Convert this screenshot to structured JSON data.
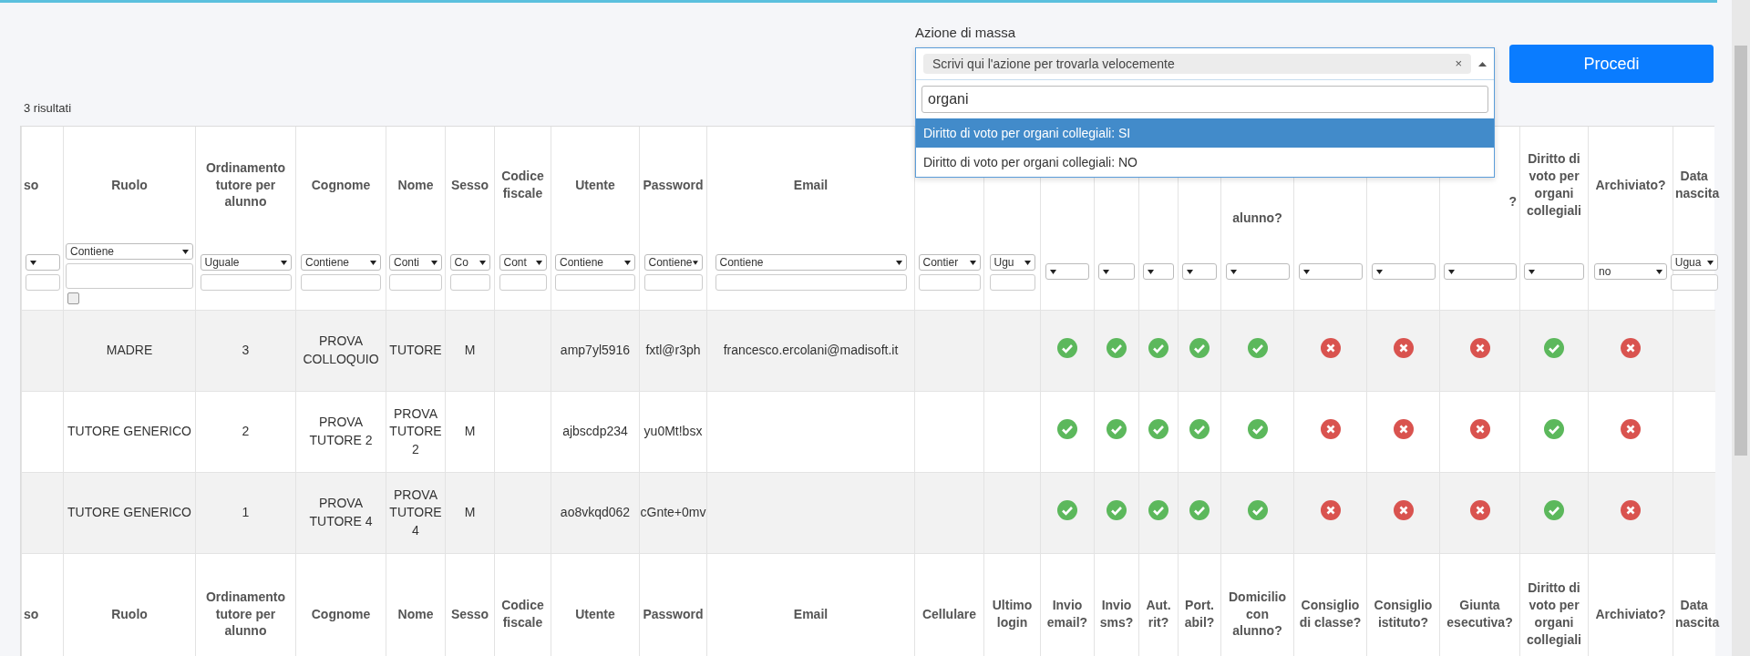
{
  "mass_action": {
    "label": "Azione di massa",
    "selection": "Scrivi qui l'azione per trovarla velocemente",
    "clear": "×",
    "search": "organi",
    "options": [
      {
        "label": "Diritto di voto per organi collegiali: SI",
        "selected": true
      },
      {
        "label": "Diritto di voto per organi collegiali: NO",
        "selected": false
      }
    ]
  },
  "proceed_button": "Procedi",
  "result_count": "3 risultati",
  "table": {
    "header_left": [
      "so",
      "Ruolo",
      "Ordinamento tutore per alunno",
      "Cognome",
      "Nome",
      "Sesso",
      "Codice fiscale",
      "Utente",
      "Password",
      "Email"
    ],
    "header_under_dropdown": [
      "alunno?",
      "?"
    ],
    "header_right": [
      "Diritto di voto per organi collegiali",
      "Archiviato?",
      "Data nascita"
    ],
    "filters": [
      {
        "kind": "text"
      },
      {
        "kind": "area",
        "select": "Contiene",
        "checked": false
      },
      {
        "kind": "text",
        "select": "Uguale"
      },
      {
        "kind": "text",
        "select": "Contiene"
      },
      {
        "kind": "text",
        "select": "Conti"
      },
      {
        "kind": "text",
        "select": "Co"
      },
      {
        "kind": "text",
        "select": "Cont"
      },
      {
        "kind": "text",
        "select": "Contiene"
      },
      {
        "kind": "text",
        "select": "Contiene"
      },
      {
        "kind": "text",
        "select": "Contiene"
      },
      {
        "kind": "text",
        "select": "Contier"
      },
      {
        "kind": "text",
        "select": "Ugu"
      },
      {
        "kind": "choice"
      },
      {
        "kind": "choice"
      },
      {
        "kind": "choice"
      },
      {
        "kind": "choice"
      },
      {
        "kind": "choice"
      },
      {
        "kind": "choice"
      },
      {
        "kind": "choice"
      },
      {
        "kind": "choice"
      },
      {
        "kind": "choice"
      },
      {
        "kind": "choice",
        "select": "no"
      },
      {
        "kind": "text",
        "select": "Ugua"
      }
    ],
    "rows": [
      {
        "cells": [
          null,
          "MADRE",
          "3",
          "PROVA COLLOQUIO",
          "TUTORE",
          "M",
          null,
          "amp7yl5916",
          "fxtl@r3ph",
          "francesco.ercolani@madisoft.it",
          null,
          null
        ],
        "flags": [
          true,
          true,
          true,
          true,
          true,
          false,
          false,
          false,
          true,
          false
        ]
      },
      {
        "cells": [
          null,
          "TUTORE GENERICO",
          "2",
          "PROVA TUTORE 2",
          "PROVA TUTORE 2",
          "M",
          null,
          "ajbscdp234",
          "yu0Mt!bsx",
          null,
          null,
          null
        ],
        "flags": [
          true,
          true,
          true,
          true,
          true,
          false,
          false,
          false,
          true,
          false
        ]
      },
      {
        "cells": [
          null,
          "TUTORE GENERICO",
          "1",
          "PROVA TUTORE 4",
          "PROVA TUTORE 4",
          "M",
          null,
          "ao8vkqd062",
          "cGnte+0mv",
          null,
          null,
          null
        ],
        "flags": [
          true,
          true,
          true,
          true,
          true,
          false,
          false,
          false,
          true,
          false
        ]
      }
    ],
    "footer": [
      "so",
      "Ruolo",
      "Ordinamento tutore per alunno",
      "Cognome",
      "Nome",
      "Sesso",
      "Codice fiscale",
      "Utente",
      "Password",
      "Email",
      "Cellulare",
      "Ultimo login",
      "Invio email?",
      "Invio sms?",
      "Aut. rit?",
      "Port. abil?",
      "Domicilio con alunno?",
      "Consiglio di classe?",
      "Consiglio istituto?",
      "Giunta esecutiva?",
      "Diritto di voto per organi collegiali",
      "Archiviato?",
      "Data nascita"
    ]
  }
}
